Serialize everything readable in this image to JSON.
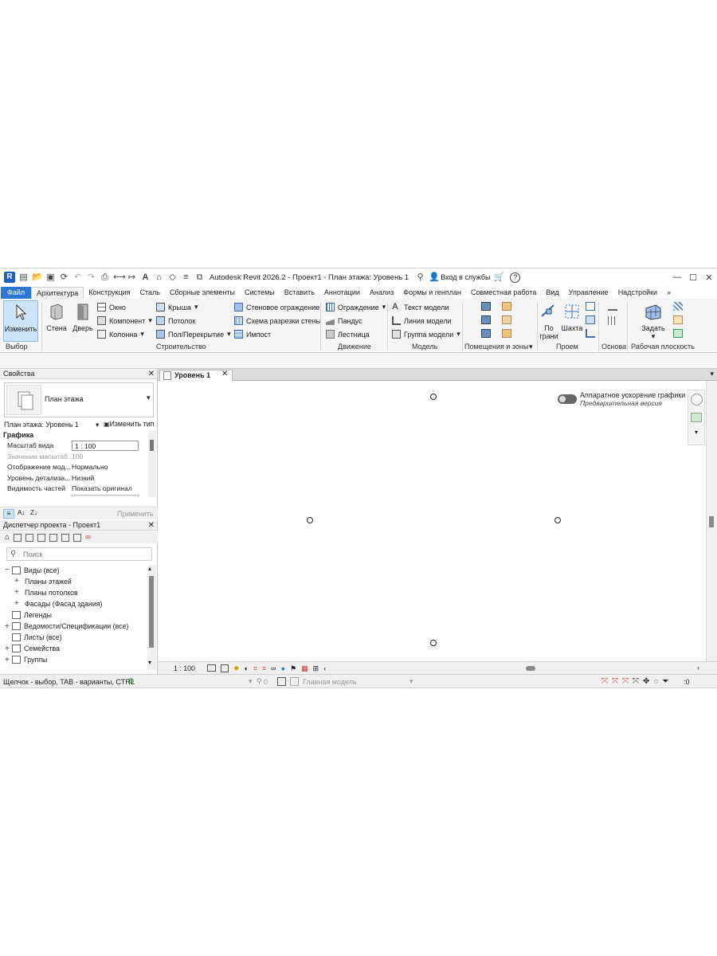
{
  "window": {
    "title": "Autodesk Revit 2026.2 - Проект1 - План этажа: Уровень 1",
    "app_badge": "R",
    "signin": "Вход в службы",
    "help": "?",
    "controls": {
      "minimize": "—",
      "maximize": "☐",
      "close": "✕"
    }
  },
  "tabs": [
    "Файл",
    "Архитектура",
    "Конструкция",
    "Сталь",
    "Сборные элементы",
    "Системы",
    "Вставить",
    "Аннотации",
    "Анализ",
    "Формы и генплан",
    "Совместная работа",
    "Вид",
    "Управление",
    "Надстройки"
  ],
  "ribbon": {
    "select": {
      "modify": "Изменить",
      "label": "Выбор"
    },
    "build": {
      "wall": "Стена",
      "door": "Дверь",
      "window": "Окно",
      "component": "Компонент",
      "column": "Колонна",
      "roof": "Крыша",
      "ceiling": "Потолок",
      "floor": "Пол/Перекрытие",
      "curtain_system": "Стеновое ограждение",
      "curtain_grid": "Схема разрезки стены",
      "mullion": "Импост",
      "label": "Строительство"
    },
    "circulation": {
      "railing": "Ограждение",
      "ramp": "Пандус",
      "stair": "Лестница",
      "label": "Движение"
    },
    "model": {
      "text": "Текст модели",
      "line": "Линия модели",
      "group": "Группа модели",
      "label": "Модель"
    },
    "room": {
      "label": "Помещения и зоны"
    },
    "opening": {
      "by_face_1": "По",
      "by_face_2": "грани",
      "shaft": "Шахта",
      "label": "Проем"
    },
    "datum": {
      "label": "Основа"
    },
    "workplane": {
      "set": "Задать",
      "label": "Рабочая плоскость"
    }
  },
  "properties": {
    "title": "Свойства",
    "type_name": "План этажа",
    "instance": "План этажа: Уровень 1",
    "edit_type": "Изменить тип",
    "section": "Графика",
    "rows": [
      {
        "k": "Масштаб вида",
        "v": "1 : 100"
      },
      {
        "k": "Значение масштаб...",
        "v": "100"
      },
      {
        "k": "Отображение мод...",
        "v": "Нормально"
      },
      {
        "k": "Уровень детализа...",
        "v": "Низкий"
      },
      {
        "k": "Видимость частей",
        "v": "Показать оригинал"
      },
      {
        "k": "Переопределения...",
        "v": "Изменить..."
      }
    ],
    "apply": "Применить"
  },
  "browser": {
    "title": "Диспетчер проекта - Проект1",
    "search_placeholder": "Поиск",
    "items": [
      {
        "label": "Виды (все)",
        "sign": "−",
        "indent": 0
      },
      {
        "label": "Планы этажей",
        "sign": "+",
        "indent": 1
      },
      {
        "label": "Планы потолков",
        "sign": "+",
        "indent": 1
      },
      {
        "label": "Фасады (Фасад здания)",
        "sign": "+",
        "indent": 1
      },
      {
        "label": "Легенды",
        "sign": "",
        "indent": 0
      },
      {
        "label": "Ведомости/Спецификации (все)",
        "sign": "+",
        "indent": 0
      },
      {
        "label": "Листы (все)",
        "sign": "",
        "indent": 0
      },
      {
        "label": "Семейства",
        "sign": "+",
        "indent": 0
      },
      {
        "label": "Группы",
        "sign": "+",
        "indent": 0
      }
    ]
  },
  "view": {
    "tab": "Уровень 1",
    "hw_accel": "Аппаратное ускорение графики",
    "preview": "Предварительная версия",
    "scale": "1 : 100"
  },
  "status": {
    "hint": "Щелчок - выбор, TAB - варианты, CTRL",
    "count": "0",
    "model": "Главная модель",
    "filter": ":0"
  }
}
